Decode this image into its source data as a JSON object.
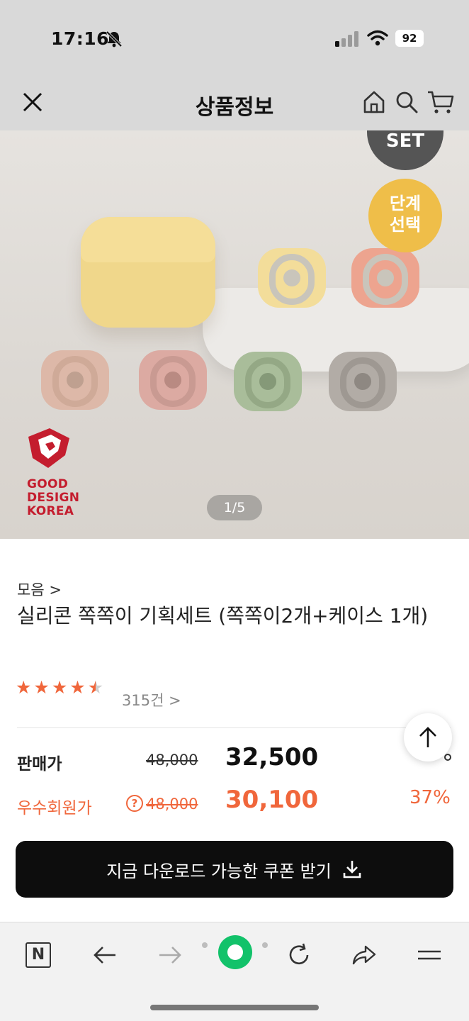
{
  "status": {
    "time": "17:16",
    "battery": "92"
  },
  "header": {
    "title": "상품정보"
  },
  "hero": {
    "set_badge": "SET",
    "step_badge_line1": "단계",
    "step_badge_line2": "선택",
    "logo_text": [
      "GOOD",
      "DESIGN",
      "KOREA"
    ],
    "pager": "1/5"
  },
  "product": {
    "breadcrumb": "모음 >",
    "name": "실리콘 쪽쪽이 기획세트 (쪽쪽이2개+케이스 1개)",
    "rating": 4.5,
    "review_count": "315건 >"
  },
  "pricing": {
    "sale_label": "판매가",
    "sale_original": "48,000",
    "sale_price": "32,500",
    "member_label": "우수회원가",
    "help_icon": "?",
    "member_original": "48,000",
    "member_price": "30,100",
    "member_discount": "37%"
  },
  "coupon": {
    "label": "지금 다운로드 가능한 쿠폰 받기"
  },
  "colors": {
    "accent": "#f0663b",
    "button_bg": "#0d0d0d",
    "brand_green": "#12c26a"
  },
  "toolbar": {
    "n_label": "N"
  }
}
